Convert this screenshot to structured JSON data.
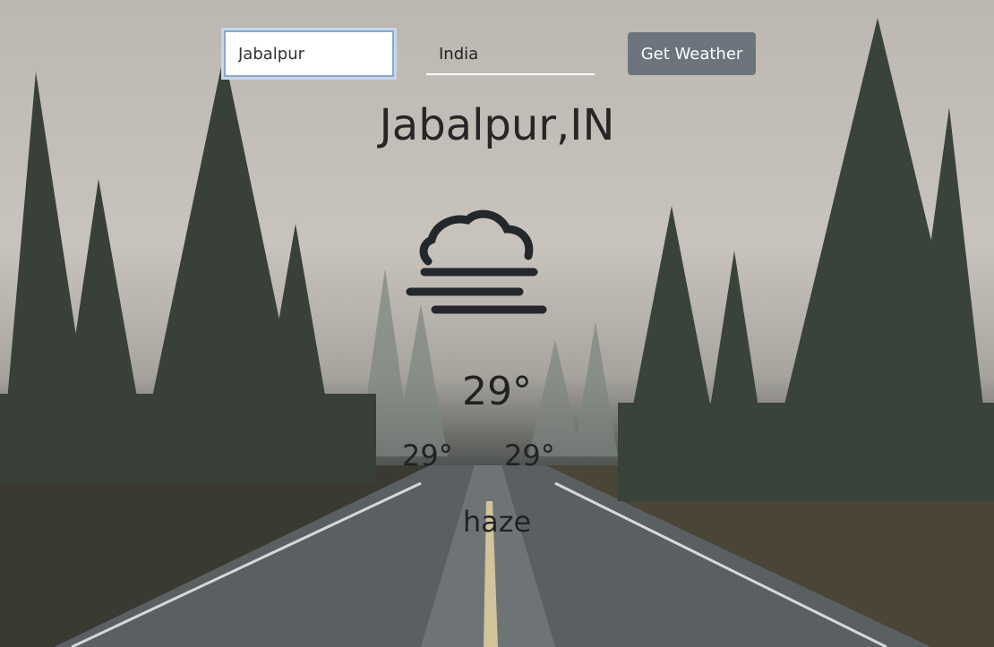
{
  "search": {
    "city_value": "Jabalpur",
    "country_value": "India",
    "button_label": "Get Weather"
  },
  "weather": {
    "location": "Jabalpur,IN",
    "icon": "haze-icon",
    "temperature": "29°",
    "temp_min": "29°",
    "temp_max": "29°",
    "condition": "haze"
  },
  "colors": {
    "button_bg": "#6c757d",
    "text": "#222222"
  }
}
